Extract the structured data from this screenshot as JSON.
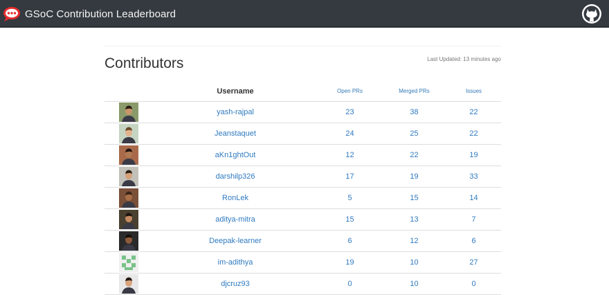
{
  "navbar": {
    "brand_title": "GSoC Contribution Leaderboard",
    "brand_icon": "rocketchat-logo-icon",
    "github_icon": "github-icon",
    "background_color": "#343a40"
  },
  "main": {
    "title": "Contributors",
    "last_updated": "Last Updated: 13 minutes ago"
  },
  "table": {
    "headers": {
      "avatar": "",
      "username": "Username",
      "open_prs": "Open PRs",
      "merged_prs": "Merged PRs",
      "issues": "Issues"
    },
    "link_color": "#337ab7",
    "rows": [
      {
        "username": "yash-rajpal",
        "open_prs": "23",
        "merged_prs": "38",
        "issues": "22",
        "avatar": "user-avatar-photo"
      },
      {
        "username": "Jeanstaquet",
        "open_prs": "24",
        "merged_prs": "25",
        "issues": "22",
        "avatar": "user-avatar-photo"
      },
      {
        "username": "aKn1ghtOut",
        "open_prs": "12",
        "merged_prs": "22",
        "issues": "19",
        "avatar": "user-avatar-photo"
      },
      {
        "username": "darshilp326",
        "open_prs": "17",
        "merged_prs": "19",
        "issues": "33",
        "avatar": "user-avatar-photo"
      },
      {
        "username": "RonLek",
        "open_prs": "5",
        "merged_prs": "15",
        "issues": "14",
        "avatar": "user-avatar-photo"
      },
      {
        "username": "aditya-mitra",
        "open_prs": "15",
        "merged_prs": "13",
        "issues": "7",
        "avatar": "user-avatar-photo"
      },
      {
        "username": "Deepak-learner",
        "open_prs": "6",
        "merged_prs": "12",
        "issues": "6",
        "avatar": "user-avatar-photo"
      },
      {
        "username": "im-adithya",
        "open_prs": "19",
        "merged_prs": "10",
        "issues": "27",
        "avatar": "identicon-avatar"
      },
      {
        "username": "djcruz93",
        "open_prs": "0",
        "merged_prs": "10",
        "issues": "0",
        "avatar": "user-avatar-photo"
      }
    ]
  }
}
